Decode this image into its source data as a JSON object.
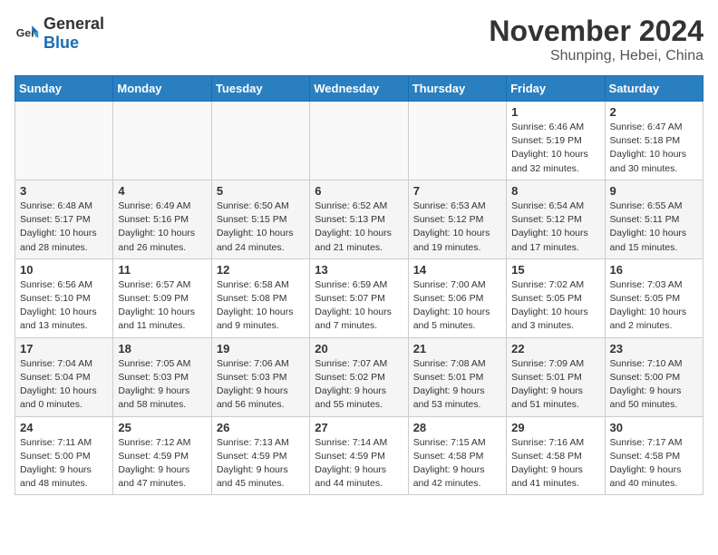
{
  "header": {
    "logo": {
      "general": "General",
      "blue": "Blue"
    },
    "title": "November 2024",
    "location": "Shunping, Hebei, China"
  },
  "weekdays": [
    "Sunday",
    "Monday",
    "Tuesday",
    "Wednesday",
    "Thursday",
    "Friday",
    "Saturday"
  ],
  "weeks": [
    [
      {
        "day": "",
        "info": ""
      },
      {
        "day": "",
        "info": ""
      },
      {
        "day": "",
        "info": ""
      },
      {
        "day": "",
        "info": ""
      },
      {
        "day": "",
        "info": ""
      },
      {
        "day": "1",
        "info": "Sunrise: 6:46 AM\nSunset: 5:19 PM\nDaylight: 10 hours and 32 minutes."
      },
      {
        "day": "2",
        "info": "Sunrise: 6:47 AM\nSunset: 5:18 PM\nDaylight: 10 hours and 30 minutes."
      }
    ],
    [
      {
        "day": "3",
        "info": "Sunrise: 6:48 AM\nSunset: 5:17 PM\nDaylight: 10 hours and 28 minutes."
      },
      {
        "day": "4",
        "info": "Sunrise: 6:49 AM\nSunset: 5:16 PM\nDaylight: 10 hours and 26 minutes."
      },
      {
        "day": "5",
        "info": "Sunrise: 6:50 AM\nSunset: 5:15 PM\nDaylight: 10 hours and 24 minutes."
      },
      {
        "day": "6",
        "info": "Sunrise: 6:52 AM\nSunset: 5:13 PM\nDaylight: 10 hours and 21 minutes."
      },
      {
        "day": "7",
        "info": "Sunrise: 6:53 AM\nSunset: 5:12 PM\nDaylight: 10 hours and 19 minutes."
      },
      {
        "day": "8",
        "info": "Sunrise: 6:54 AM\nSunset: 5:12 PM\nDaylight: 10 hours and 17 minutes."
      },
      {
        "day": "9",
        "info": "Sunrise: 6:55 AM\nSunset: 5:11 PM\nDaylight: 10 hours and 15 minutes."
      }
    ],
    [
      {
        "day": "10",
        "info": "Sunrise: 6:56 AM\nSunset: 5:10 PM\nDaylight: 10 hours and 13 minutes."
      },
      {
        "day": "11",
        "info": "Sunrise: 6:57 AM\nSunset: 5:09 PM\nDaylight: 10 hours and 11 minutes."
      },
      {
        "day": "12",
        "info": "Sunrise: 6:58 AM\nSunset: 5:08 PM\nDaylight: 10 hours and 9 minutes."
      },
      {
        "day": "13",
        "info": "Sunrise: 6:59 AM\nSunset: 5:07 PM\nDaylight: 10 hours and 7 minutes."
      },
      {
        "day": "14",
        "info": "Sunrise: 7:00 AM\nSunset: 5:06 PM\nDaylight: 10 hours and 5 minutes."
      },
      {
        "day": "15",
        "info": "Sunrise: 7:02 AM\nSunset: 5:05 PM\nDaylight: 10 hours and 3 minutes."
      },
      {
        "day": "16",
        "info": "Sunrise: 7:03 AM\nSunset: 5:05 PM\nDaylight: 10 hours and 2 minutes."
      }
    ],
    [
      {
        "day": "17",
        "info": "Sunrise: 7:04 AM\nSunset: 5:04 PM\nDaylight: 10 hours and 0 minutes."
      },
      {
        "day": "18",
        "info": "Sunrise: 7:05 AM\nSunset: 5:03 PM\nDaylight: 9 hours and 58 minutes."
      },
      {
        "day": "19",
        "info": "Sunrise: 7:06 AM\nSunset: 5:03 PM\nDaylight: 9 hours and 56 minutes."
      },
      {
        "day": "20",
        "info": "Sunrise: 7:07 AM\nSunset: 5:02 PM\nDaylight: 9 hours and 55 minutes."
      },
      {
        "day": "21",
        "info": "Sunrise: 7:08 AM\nSunset: 5:01 PM\nDaylight: 9 hours and 53 minutes."
      },
      {
        "day": "22",
        "info": "Sunrise: 7:09 AM\nSunset: 5:01 PM\nDaylight: 9 hours and 51 minutes."
      },
      {
        "day": "23",
        "info": "Sunrise: 7:10 AM\nSunset: 5:00 PM\nDaylight: 9 hours and 50 minutes."
      }
    ],
    [
      {
        "day": "24",
        "info": "Sunrise: 7:11 AM\nSunset: 5:00 PM\nDaylight: 9 hours and 48 minutes."
      },
      {
        "day": "25",
        "info": "Sunrise: 7:12 AM\nSunset: 4:59 PM\nDaylight: 9 hours and 47 minutes."
      },
      {
        "day": "26",
        "info": "Sunrise: 7:13 AM\nSunset: 4:59 PM\nDaylight: 9 hours and 45 minutes."
      },
      {
        "day": "27",
        "info": "Sunrise: 7:14 AM\nSunset: 4:59 PM\nDaylight: 9 hours and 44 minutes."
      },
      {
        "day": "28",
        "info": "Sunrise: 7:15 AM\nSunset: 4:58 PM\nDaylight: 9 hours and 42 minutes."
      },
      {
        "day": "29",
        "info": "Sunrise: 7:16 AM\nSunset: 4:58 PM\nDaylight: 9 hours and 41 minutes."
      },
      {
        "day": "30",
        "info": "Sunrise: 7:17 AM\nSunset: 4:58 PM\nDaylight: 9 hours and 40 minutes."
      }
    ]
  ]
}
